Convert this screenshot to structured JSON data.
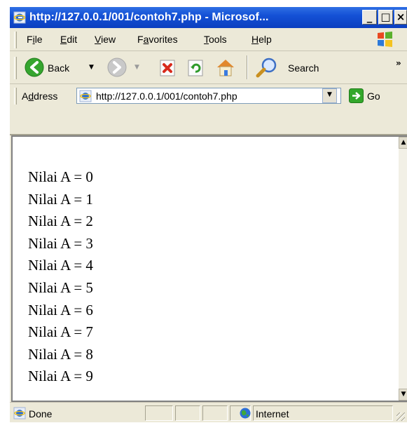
{
  "window": {
    "title": "http://127.0.0.1/001/contoh7.php - Microsof...",
    "buttons": {
      "minimize": "_",
      "maximize": "□",
      "close": "×"
    }
  },
  "menu": {
    "items": [
      {
        "text": "File",
        "underline": "i"
      },
      {
        "text": "Edit",
        "underline": "E"
      },
      {
        "text": "View",
        "underline": "V"
      },
      {
        "text": "Favorites",
        "underline": "a"
      },
      {
        "text": "Tools",
        "underline": "T"
      },
      {
        "text": "Help",
        "underline": "H"
      }
    ]
  },
  "toolbar": {
    "back_label": "Back",
    "search_label": "Search",
    "chevron": "»"
  },
  "address": {
    "label_prefix": "A",
    "label_underlined": "d",
    "label_rest": "dress",
    "url": "http://127.0.0.1/001/contoh7.php",
    "go_label": "Go"
  },
  "content": {
    "lines": [
      "Nilai A = 0",
      "Nilai A = 1",
      "Nilai A = 2",
      "Nilai A = 3",
      "Nilai A = 4",
      "Nilai A = 5",
      "Nilai A = 6",
      "Nilai A = 7",
      "Nilai A = 8",
      "Nilai A = 9"
    ]
  },
  "status": {
    "left_text": "Done",
    "zone_text": "Internet"
  },
  "colors": {
    "titlebar": "#0b3fbf",
    "chrome": "#ece9d8",
    "go_green": "#2ea12b"
  }
}
